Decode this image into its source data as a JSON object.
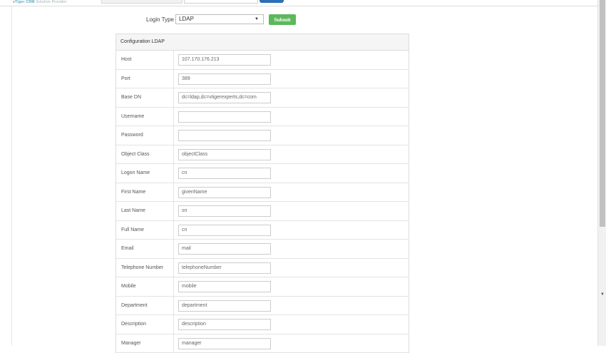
{
  "header": {
    "brand_main": "vTiger CRM",
    "brand_sub": "Solution Provider"
  },
  "login": {
    "label": "Login Type",
    "selected": "LDAP",
    "submit_label": "Submit"
  },
  "config": {
    "title": "Configuration LDAP",
    "rows": [
      {
        "label": "Host",
        "value": "107.170.176.213"
      },
      {
        "label": "Port",
        "value": "389"
      },
      {
        "label": "Base DN",
        "value": "dc=ldap,dc=vtigerexperts,dc=com"
      },
      {
        "label": "Username",
        "value": ""
      },
      {
        "label": "Password",
        "value": ""
      },
      {
        "label": "Object Class",
        "value": "objectClass"
      },
      {
        "label": "Logon Name",
        "value": "cn"
      },
      {
        "label": "First Name",
        "value": "givenName"
      },
      {
        "label": "Last Name",
        "value": "sn"
      },
      {
        "label": "Full Name",
        "value": "cn"
      },
      {
        "label": "Email",
        "value": "mail"
      },
      {
        "label": "Telephone Number",
        "value": "telephoneNumber"
      },
      {
        "label": "Mobile",
        "value": "mobile"
      },
      {
        "label": "Department",
        "value": "department"
      },
      {
        "label": "Description",
        "value": "description"
      },
      {
        "label": "Manager",
        "value": "manager"
      }
    ]
  }
}
